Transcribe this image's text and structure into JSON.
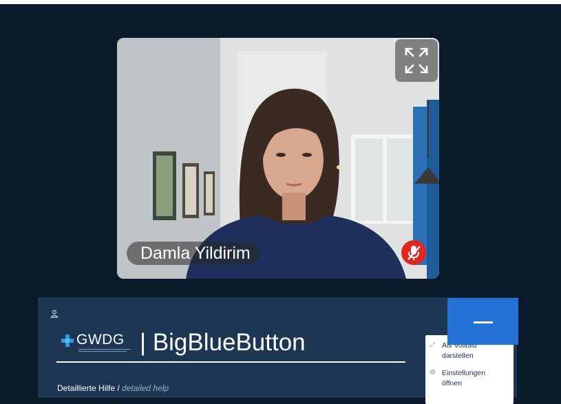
{
  "video": {
    "participant_name": "Damla Yildirim",
    "fullscreen_icon": "fullscreen-expand-icon",
    "mic_status_icon": "muted-microphone-icon",
    "colors": {
      "mute_badge": "#df2721",
      "name_tag_text": "#ffffff"
    }
  },
  "help_panel": {
    "user_icon": "user-icon",
    "logo_text": "GWDG",
    "title": "| BigBlueButton",
    "help_de": "Detaillierte Hilfe",
    "help_sep": " / ",
    "help_en": "detailed help"
  },
  "popup_menu": {
    "items": [
      {
        "icon": "fullscreen-icon",
        "label_line1": "Als Vollbild",
        "label_line2": "darstellen"
      },
      {
        "icon": "gear-icon",
        "label_line1": "Einstellungen",
        "label_line2": "öffnen"
      }
    ]
  },
  "minimize_button": {
    "icon": "minimize-icon",
    "color": "#2273d4"
  },
  "colors": {
    "background": "#0b1a2b",
    "panel": "#1c3654"
  }
}
